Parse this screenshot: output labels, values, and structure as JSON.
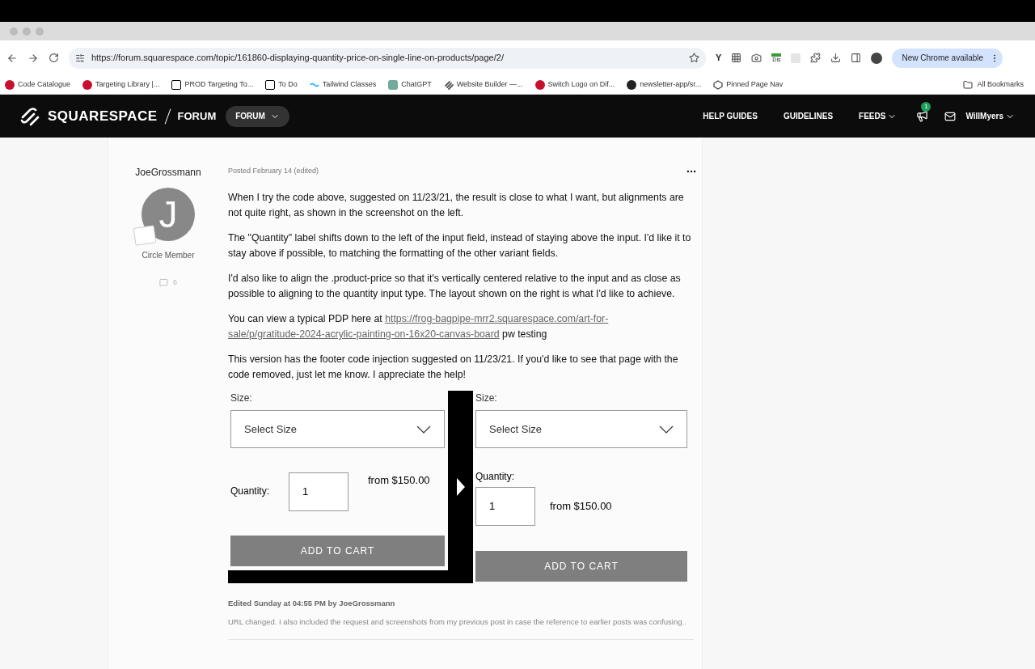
{
  "browser": {
    "url": "https://forum.squarespace.com/topic/161860-displaying-quantity-price-on-single-line-on-products/page/2/",
    "ext_label": "Dis",
    "y_ext": "Y",
    "update_button": "New Chrome available",
    "bookmarks": [
      {
        "label": "Code Catalogue",
        "kind": "w"
      },
      {
        "label": "Targeting Library |...",
        "kind": "w"
      },
      {
        "label": "PROD Targeting To...",
        "kind": "n"
      },
      {
        "label": "To Do",
        "kind": "n"
      },
      {
        "label": "Tailwind Classes",
        "kind": "tw"
      },
      {
        "label": "ChatGPT",
        "kind": "gpt"
      },
      {
        "label": "Website Builder —...",
        "kind": "sq"
      },
      {
        "label": "Switch Logo on Dif...",
        "kind": "w"
      },
      {
        "label": "newsletter-app/sr...",
        "kind": "gh"
      },
      {
        "label": "Pinned Page Nav",
        "kind": "cp"
      }
    ],
    "all_bookmarks": "All Bookmarks"
  },
  "nav": {
    "brand": "SQUARESPACE",
    "section": "FORUM",
    "dropdown": "FORUM",
    "links": [
      {
        "label": "HELP GUIDES",
        "dropdown": false
      },
      {
        "label": "GUIDELINES",
        "dropdown": false
      },
      {
        "label": "FEEDS",
        "dropdown": true
      }
    ],
    "notification_count": "1",
    "user": "WillMyers"
  },
  "post": {
    "author": "JoeGrossmann",
    "avatar_letter": "J",
    "role": "Circle Member",
    "comment_count": "6",
    "posted": "Posted February 14 (edited)",
    "paragraphs": [
      [
        {
          "text": "When I try the code above, suggested on 11/23/21, the result is close to what I want, but alignments are not quite right, as shown in the screenshot on the left.",
          "link": false
        }
      ],
      [
        {
          "text": "The \"Quantity\" label shifts down to the left of the input field, instead of staying above the input. I'd like it to stay above if possible,  to matching the formatting of the other variant fields.",
          "link": false
        }
      ],
      [
        {
          "text": "I'd also like to align the .product-price so that it's vertically centered relative to the input and as close as possible to aligning to the quantity input type. The layout shown on the right is what I'd like to achieve.",
          "link": false
        }
      ],
      [
        {
          "text": "You can view a typical PDP here at ",
          "link": false
        },
        {
          "text": "https://frog-bagpipe-mrr2.squarespace.com/art-for-",
          "link": true
        },
        {
          "text": "sale/p/gratitude-2024-acrylic-painting-on-16x20-canvas-board",
          "link": true
        },
        {
          "text": " pw testing",
          "link": false
        }
      ],
      [
        {
          "text": "This version has the footer code injection suggested on 11/23/21. If you'd like to see that page with the code removed, just let me know. I appreciate the help!",
          "link": false
        }
      ]
    ],
    "screenshot": [
      {
        "kind": "inline",
        "size_label": "Size:",
        "select": "Select Size",
        "quantity_label": "Quantity:",
        "quantity": "1",
        "price": "from $150.00",
        "button": "ADD TO CART"
      },
      {
        "kind": "stacked",
        "size_label": "Size:",
        "select": "Select Size",
        "quantity_label": "Quantity:",
        "quantity": "1",
        "price": "from $150.00",
        "button": "ADD TO CART"
      }
    ],
    "edited_by": "Edited Sunday at 04:55 PM by JoeGrossmann",
    "edit_note": "URL changed. I also included the request and screenshots from my previous post in case the reference to earlier posts was confusing.."
  }
}
